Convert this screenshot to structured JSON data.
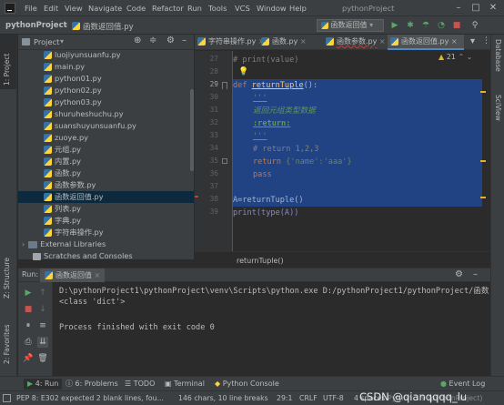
{
  "menu": [
    "File",
    "Edit",
    "View",
    "Navigate",
    "Code",
    "Refactor",
    "Run",
    "Tools",
    "VCS",
    "Window",
    "Help"
  ],
  "window_title": "pythonProject",
  "breadcrumb": {
    "project": "pythonProject",
    "file": "函数返回值.py"
  },
  "run_config": "函数返回值",
  "project_panel": {
    "title": "Project",
    "files": [
      "luojiyunsuanfu.py",
      "main.py",
      "python01.py",
      "python02.py",
      "python03.py",
      "shuruheshuchu.py",
      "suanshuyunsuanfu.py",
      "zuoye.py",
      "元组.py",
      "内置.py",
      "函数.py",
      "函数参数.py",
      "函数返回值.py",
      "列表.py",
      "字典.py",
      "字符串操作.py"
    ],
    "selected": "函数返回值.py",
    "external": "External Libraries",
    "scratches": "Scratches and Consoles"
  },
  "tabs": [
    "字符串操作.py",
    "函数.py",
    "函数参数.py",
    "函数返回值.py"
  ],
  "active_tab": "函数返回值.py",
  "editor": {
    "line_numbers": [
      "27",
      "28",
      "29",
      "30",
      "31",
      "32",
      "33",
      "34",
      "35",
      "36",
      "37",
      "38",
      "39"
    ],
    "lines": {
      "l27": "# print(value)",
      "l29_kw": "def ",
      "l29_fn": "returnTuple",
      "l29_rest": "():",
      "l30": "'''",
      "l31": "返回元组类型数据",
      "l32": ":return:",
      "l33": "'''",
      "l34": "# return 1,2,3",
      "l35_kw": "return ",
      "l35_rest": "{'name':'aaa'}",
      "l36": "pass",
      "l38": "A=returnTuple()",
      "l39": "print(type(A))"
    },
    "inspection_count": "21",
    "breadcrumb": "returnTuple()"
  },
  "run_panel": {
    "label": "Run:",
    "config": "函数返回值",
    "output": [
      "D:\\pythonProject1\\pythonProject\\venv\\Scripts\\python.exe D:/pythonProject1/pythonProject/函数",
      "<class 'dict'>",
      "",
      "Process finished with exit code 0"
    ]
  },
  "left_stripe": {
    "project": "1: Project",
    "structure": "Z: Structure",
    "favorites": "2: Favorites"
  },
  "right_stripe": {
    "database": "Database",
    "sciview": "SciView"
  },
  "bottom_tabs": [
    "4: Run",
    "6: Problems",
    "TODO",
    "Terminal",
    "Python Console"
  ],
  "event_log": "Event Log",
  "status": {
    "message": "PEP 8: E302 expected 2 blank lines, fou...",
    "chars": "146 chars, 10 line breaks",
    "pos": "29:1",
    "crlf": "CRLF",
    "enc": "UTF-8",
    "indent": "4 spaces",
    "interp": "Python 3.9 (pythonProject)",
    "watermark": "CSDN @qianqqqq_lu"
  },
  "colors": {
    "keyword": "#cc7832",
    "function": "#ffc66d",
    "string": "#6a8759",
    "comment": "#808080",
    "docstring": "#629755",
    "selection": "#214283"
  }
}
